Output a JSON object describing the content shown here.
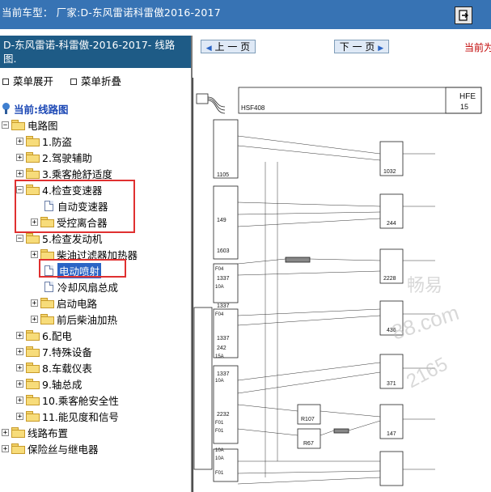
{
  "header": {
    "title": "当前车型：  厂家:D-东风雷诺科雷傲2016-2017",
    "exit_icon": "exit-door-icon"
  },
  "colors": {
    "header_bg": "#3773b4",
    "panel_header_bg": "#1e5b86",
    "selection": "#2a64c5",
    "annotation_red": "#e03030",
    "page_info_red": "#c00000"
  },
  "sidebar": {
    "title": "D-东风雷诺-科雷傲-2016-2017- 线路图.",
    "expand_all": "菜单展开",
    "collapse_all": "菜单折叠",
    "current_label": "当前:线路图",
    "tree": {
      "root": "电路图",
      "n1": "1.防盗",
      "n2": "2.驾驶辅助",
      "n3": "3.乘客舱舒适度",
      "n4": "4.检查变速器",
      "n4a": "自动变速器",
      "n4b": "受控离合器",
      "n5": "5.检查发动机",
      "n5a": "柴油过滤器加热器",
      "n5b": "电动喷射",
      "n5c": "冷却风扇总成",
      "n5d": "启动电路",
      "n5e": "前后柴油加热",
      "n6": "6.配电",
      "n7": "7.特殊设备",
      "n8": "8.车载仪表",
      "n9": "9.轴总成",
      "n10": "10.乘客舱安全性",
      "n11": "11.能见度和信号",
      "wiring": "线路布置",
      "fuses": "保险丝与继电器"
    }
  },
  "toolbar": {
    "prev_page": "上 一 页",
    "next_page": "下 一 页",
    "page_info": "当前为"
  },
  "diagram": {
    "title_code": "HFE",
    "title_num": "15",
    "connector": "HSF408",
    "components": [
      "1105",
      "149",
      "1603",
      "1337",
      "1337",
      "1337",
      "242",
      "1337",
      "2232",
      "1032",
      "244",
      "2228",
      "436",
      "371",
      "147",
      "R107",
      "R67"
    ],
    "labels_left": [
      "F04",
      "F04",
      "10A",
      "15A",
      "10A",
      "10A",
      "10A",
      "F01",
      "F01",
      "F01"
    ],
    "watermark": [
      "畅易",
      "88.com",
      "2165"
    ]
  }
}
